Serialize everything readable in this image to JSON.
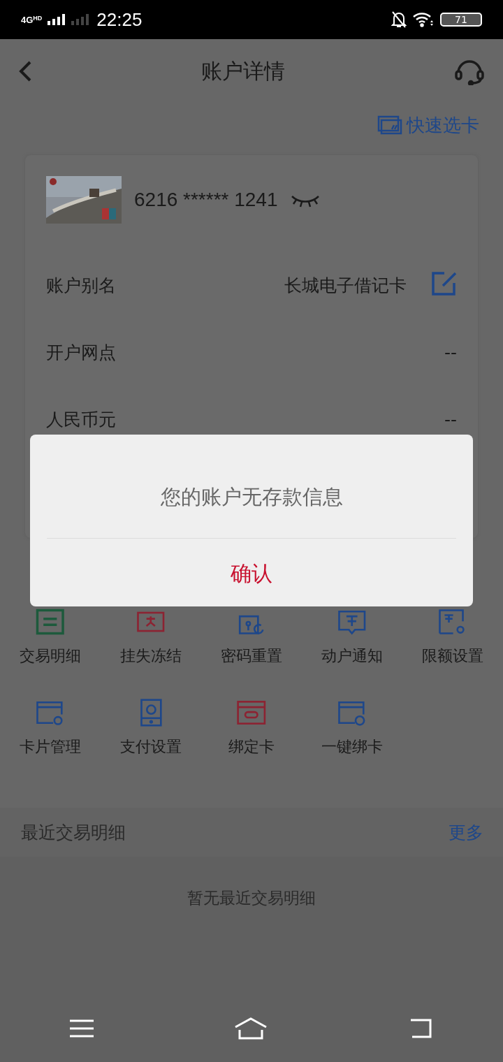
{
  "status_bar": {
    "network": "4G",
    "network_sup": "HD",
    "time": "22:25",
    "battery": "71"
  },
  "header": {
    "title": "账户详情",
    "quick_select": "快速选卡"
  },
  "card": {
    "number": "6216 ****** 1241",
    "rows": [
      {
        "label": "账户别名",
        "value": "长城电子借记卡",
        "editable": true
      },
      {
        "label": "开户网点",
        "value": "--",
        "editable": false
      },
      {
        "label": "人民币元",
        "value": "--",
        "editable": false
      }
    ]
  },
  "services": [
    {
      "kind": "list",
      "label": "交易明细",
      "color": "#1d5a3c"
    },
    {
      "kind": "lost",
      "label": "挂失冻结",
      "color": "#8c2332"
    },
    {
      "kind": "lock",
      "label": "密码重置",
      "color": "#1e478a"
    },
    {
      "kind": "notice",
      "label": "动户通知",
      "color": "#1e478a"
    },
    {
      "kind": "limit",
      "label": "限额设置",
      "color": "#1e478a"
    },
    {
      "kind": "card-gear",
      "label": "卡片管理",
      "color": "#1e478a"
    },
    {
      "kind": "pay",
      "label": "支付设置",
      "color": "#1e478a"
    },
    {
      "kind": "link",
      "label": "绑定卡",
      "color": "#8c2332"
    },
    {
      "kind": "card-search",
      "label": "一键绑卡",
      "color": "#1e478a"
    }
  ],
  "recent": {
    "title": "最近交易明细",
    "more": "更多",
    "empty": "暂无最近交易明细"
  },
  "dialog": {
    "message": "您的账户无存款信息",
    "confirm": "确认"
  }
}
